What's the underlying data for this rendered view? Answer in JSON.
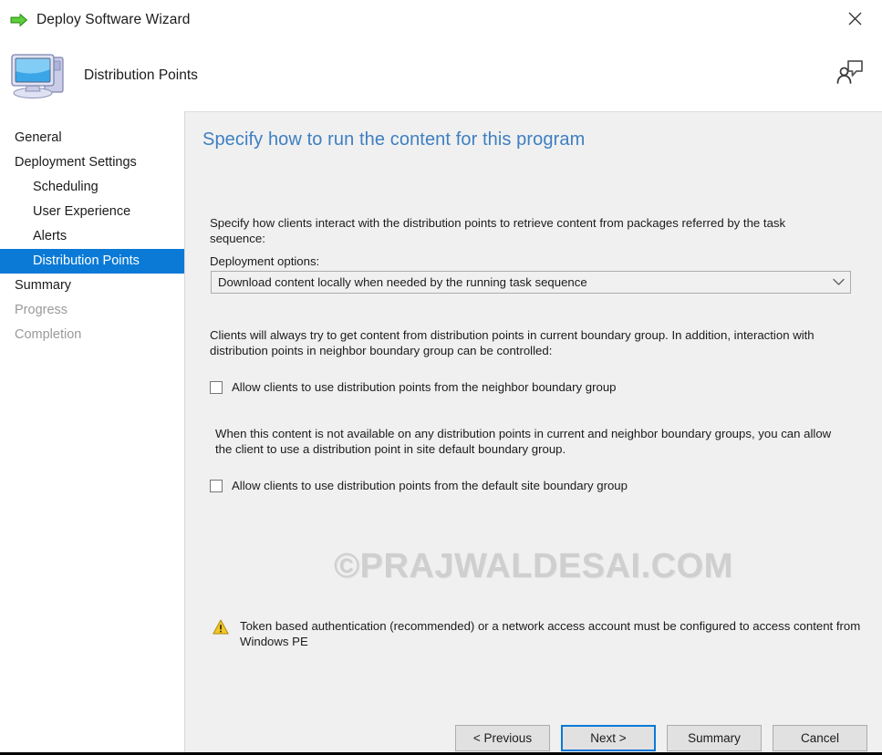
{
  "window": {
    "title": "Deploy Software Wizard",
    "title_icon": "green-arrow-icon",
    "close_icon": "close-icon"
  },
  "header": {
    "title": "Distribution Points",
    "icon": "computer-monitor-icon",
    "feedback_icon": "feedback-person-icon"
  },
  "sidebar": {
    "items": [
      {
        "label": "General",
        "state": "normal",
        "indent": false
      },
      {
        "label": "Deployment Settings",
        "state": "normal",
        "indent": false
      },
      {
        "label": "Scheduling",
        "state": "normal",
        "indent": true
      },
      {
        "label": "User Experience",
        "state": "normal",
        "indent": true
      },
      {
        "label": "Alerts",
        "state": "normal",
        "indent": true
      },
      {
        "label": "Distribution Points",
        "state": "selected",
        "indent": true
      },
      {
        "label": "Summary",
        "state": "normal",
        "indent": false
      },
      {
        "label": "Progress",
        "state": "disabled",
        "indent": false
      },
      {
        "label": "Completion",
        "state": "disabled",
        "indent": false
      }
    ],
    "selected_color": "#0a7ad6"
  },
  "main": {
    "page_title": "Specify how to run the content for this program",
    "intro_text": "Specify how clients interact with the distribution points to retrieve content from packages referred by the task sequence:",
    "deployment_options_label": "Deployment options:",
    "deployment_options_value": "Download content locally when needed by the running task sequence",
    "neighbor_description": "Clients will always try to get content from distribution points in current boundary group. In addition, interaction with distribution points in neighbor boundary group can be controlled:",
    "neighbor_checkbox_label": "Allow clients to use distribution points from the neighbor boundary group",
    "neighbor_checkbox_checked": false,
    "default_site_description": "When this content is not available on any distribution points in current and neighbor boundary groups, you can allow the client to use a distribution point in site default boundary group.",
    "default_site_checkbox_label": "Allow clients to use distribution points from the default site boundary group",
    "default_site_checkbox_checked": false,
    "watermark": "©PRAJWALDESAI.COM",
    "warning_text": "Token based authentication (recommended) or a network access account must be configured to access content from Windows PE",
    "warning_icon": "warning-triangle-icon",
    "title_color": "#3d7fc1",
    "warning_color": "#f0c420"
  },
  "footer": {
    "previous_label": "< Previous",
    "next_label": "Next >",
    "summary_label": "Summary",
    "cancel_label": "Cancel",
    "focused_button": "Next >"
  }
}
